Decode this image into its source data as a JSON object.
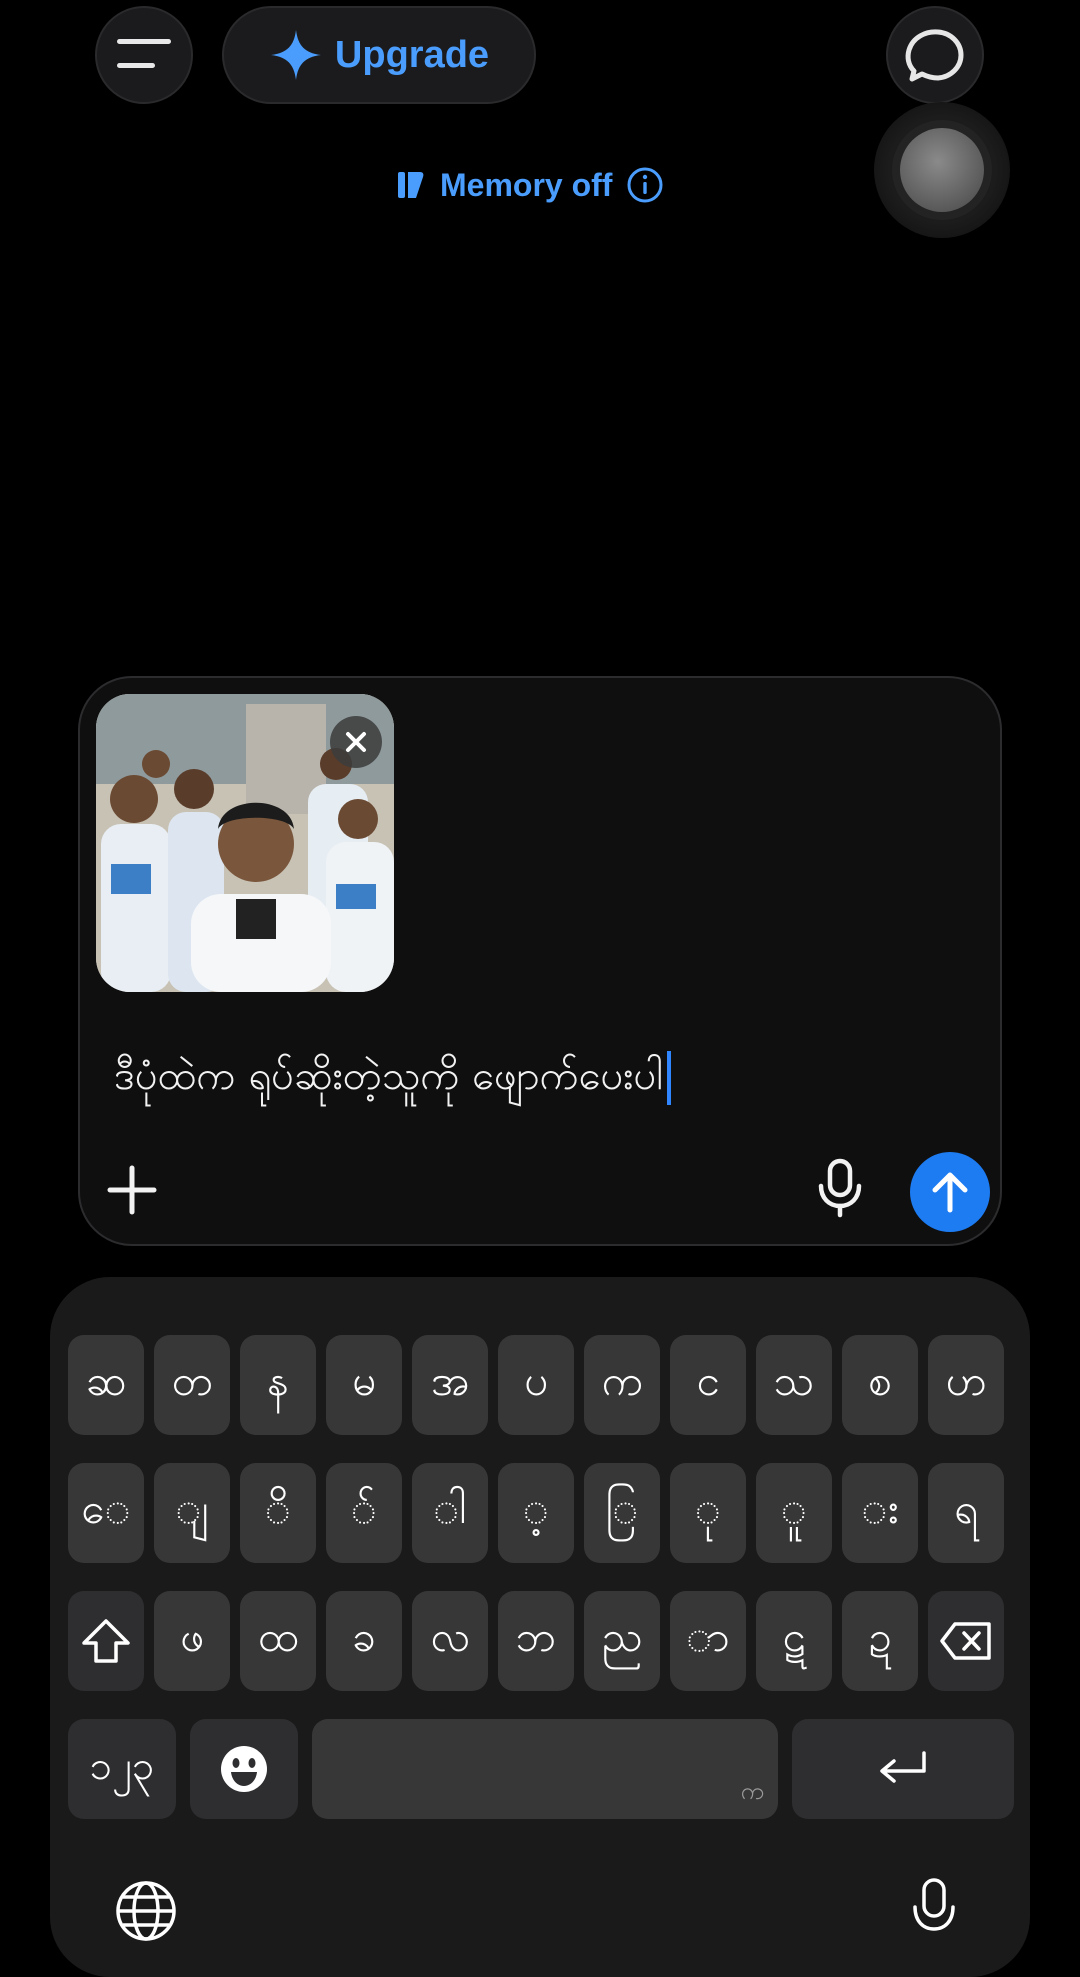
{
  "header": {
    "upgrade_label": "Upgrade",
    "memory_label": "Memory off"
  },
  "composer": {
    "text": "ဒီပုံထဲက ရုပ်ဆိုးတဲ့သူကို ဖျောက်ပေးပါ",
    "send_color": "#1d7cf2"
  },
  "keyboard": {
    "row1": [
      "ဆ",
      "တ",
      "န",
      "မ",
      "အ",
      "ပ",
      "က",
      "င",
      "သ",
      "စ",
      "ဟ"
    ],
    "row2": [
      "ေ",
      "ျ",
      "ိ",
      "်",
      "ါ",
      "့",
      "ြ",
      "ု",
      "ူ",
      "း",
      "ရ"
    ],
    "row3": [
      "ဖ",
      "ထ",
      "ခ",
      "လ",
      "ဘ",
      "ည",
      "ာ",
      "ဋ",
      "ဍ"
    ],
    "numbers_label": "၁၂၃",
    "space_hint": "က"
  },
  "colors": {
    "accent": "#4a9dfc",
    "background": "#000000"
  }
}
